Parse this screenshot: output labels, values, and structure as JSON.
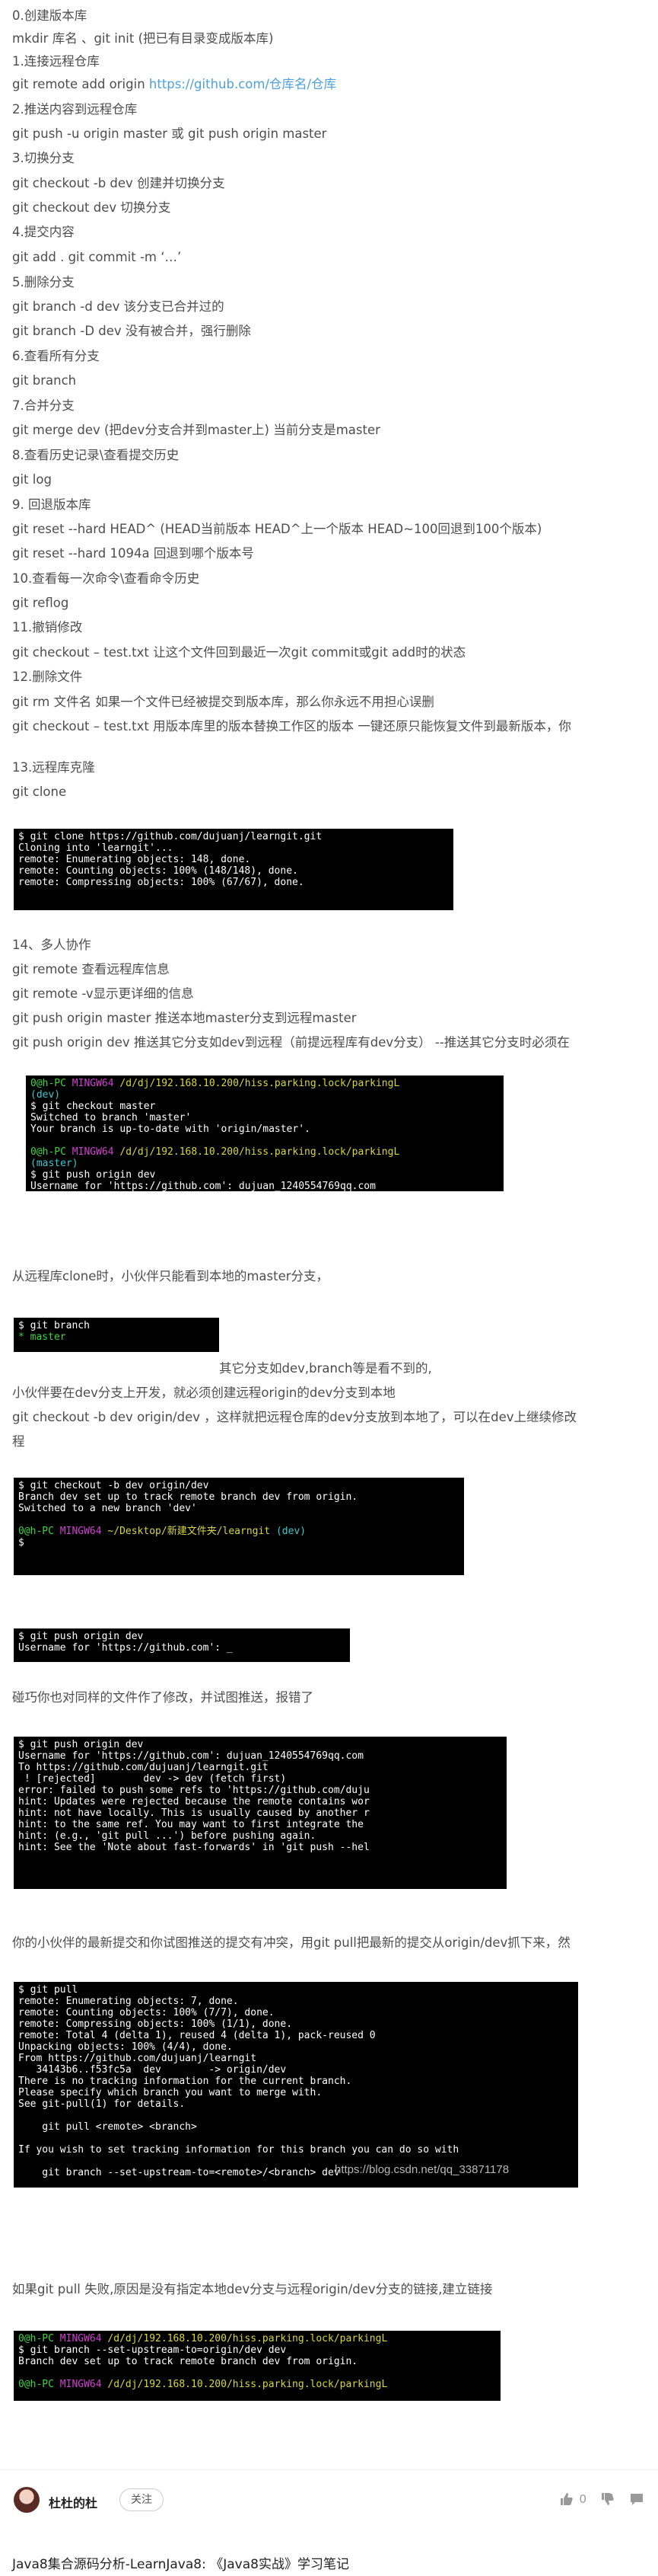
{
  "lines": [
    {
      "text": "0.创建版本库"
    },
    {
      "text": "mkdir 库名 、git init (把已有目录变成版本库)"
    },
    {
      "text": "1.连接远程仓库"
    },
    {
      "text": "git remote add origin ",
      "link": "https://github.com/仓库名/仓库"
    },
    {
      "text": "2.推送内容到远程仓库"
    },
    {
      "text": "git push -u origin master 或 git push origin master"
    },
    {
      "text": "3.切换分支"
    },
    {
      "text": "git checkout -b dev 创建并切换分支"
    },
    {
      "text": "git checkout dev 切换分支"
    },
    {
      "text": "4.提交内容"
    },
    {
      "text": "git add . git commit -m ‘…’"
    },
    {
      "text": "5.删除分支"
    },
    {
      "text": "git branch -d dev 该分支已合并过的"
    },
    {
      "text": "git branch -D dev 没有被合并，强行删除"
    },
    {
      "text": "6.查看所有分支"
    },
    {
      "text": "git branch"
    },
    {
      "text": "7.合并分支"
    },
    {
      "text": "git merge dev (把dev分支合并到master上) 当前分支是master"
    },
    {
      "text": "8.查看历史记录\\查看提交历史"
    },
    {
      "text": "git log"
    },
    {
      "text": "9. 回退版本库"
    },
    {
      "text": "git reset --hard HEAD^ (HEAD当前版本 HEAD^上一个版本 HEAD~100回退到100个版本)"
    },
    {
      "text": "git reset --hard 1094a 回退到哪个版本号"
    },
    {
      "text": "10.查看每一次命令\\查看命令历史"
    },
    {
      "text": "git reflog"
    },
    {
      "text": "11.撤销修改"
    },
    {
      "text": "git checkout – test.txt 让这个文件回到最近一次git commit或git add时的状态"
    },
    {
      "text": "12.删除文件"
    },
    {
      "text": "git rm 文件名 如果一个文件已经被提交到版本库，那么你永远不用担心误删"
    },
    {
      "text": "git checkout – test.txt 用版本库里的版本替换工作区的版本 一键还原只能恢复文件到最新版本，你"
    },
    {
      "text": "13.远程库克隆"
    },
    {
      "text": "git clone"
    },
    {
      "text": "14、多人协作"
    },
    {
      "text": "git remote 查看远程库信息"
    },
    {
      "text": "git remote -v显示更详细的信息"
    },
    {
      "text": "git push origin master 推送本地master分支到远程master"
    },
    {
      "text": "git push origin dev 推送其它分支如dev到远程（前提远程库有dev分支） --推送其它分支时必须在"
    },
    {
      "text": "从远程库clone时，小伙伴只能看到本地的master分支，"
    },
    {
      "text": "其它分支如dev,branch等是看不到的,"
    },
    {
      "text": "小伙伴要在dev分支上开发，就必须创建远程origin的dev分支到本地"
    },
    {
      "text": "git checkout -b dev origin/dev ，这样就把远程仓库的dev分支放到本地了，可以在dev上继续修改"
    },
    {
      "text": "程"
    },
    {
      "text": "碰巧你也对同样的文件作了修改，并试图推送，报错了"
    },
    {
      "text": "你的小伙伴的最新提交和你试图推送的提交有冲突，用git pull把最新的提交从origin/dev抓下来，然"
    },
    {
      "text": "如果git pull 失败,原因是没有指定本地dev分支与远程origin/dev分支的链接,建立链接"
    }
  ],
  "terminals": {
    "clone": [
      "$ git clone https://github.com/dujuanj/learngit.git",
      "Cloning into 'learngit'...",
      "remote: Enumerating objects: 148, done.",
      "remote: Counting objects: 100% (148/148), done.",
      "remote: Compressing objects: 100% (67/67), done."
    ],
    "checkout": {
      "prompt1_user": "0@h-PC",
      "prompt1_env": "MINGW64",
      "prompt1_path": "/d/dj/192.168.10.200/hiss.parking.lock/parkingL",
      "prompt1_branch": "(dev)",
      "cmd1": "$ git checkout master",
      "out1": "Switched to branch 'master'",
      "out2": "Your branch is up-to-date with 'origin/master'.",
      "prompt2_user": "0@h-PC",
      "prompt2_env": "MINGW64",
      "prompt2_path": "/d/dj/192.168.10.200/hiss.parking.lock/parkingL",
      "prompt2_branch": "(master)",
      "cmd2": "$ git push origin dev",
      "out3": "Username for 'https://github.com': dujuan_1240554769qq.com"
    },
    "branch": {
      "cmd": "$ git branch",
      "out": "* master"
    },
    "newdev": {
      "cmd": "$ git checkout -b dev origin/dev",
      "out1": "Branch dev set up to track remote branch dev from origin.",
      "out2": "Switched to a new branch 'dev'",
      "prompt_user": "0@h-PC",
      "prompt_env": "MINGW64",
      "prompt_path": "~/Desktop/新建文件夹/learngit",
      "prompt_branch": "(dev)",
      "cmd2": "$"
    },
    "pushdev": [
      "$ git push origin dev",
      "Username for 'https://github.com': _"
    ],
    "rejected": [
      "$ git push origin dev",
      "Username for 'https://github.com': dujuan_1240554769qq.com",
      "To https://github.com/dujuanj/learngit.git",
      " ! [rejected]        dev -> dev (fetch first)",
      "error: failed to push some refs to 'https://github.com/duju",
      "hint: Updates were rejected because the remote contains wor",
      "hint: not have locally. This is usually caused by another r",
      "hint: to the same ref. You may want to first integrate the ",
      "hint: (e.g., 'git pull ...') before pushing again.",
      "hint: See the 'Note about fast-forwards' in 'git push --hel"
    ],
    "pull": [
      "$ git pull",
      "remote: Enumerating objects: 7, done.",
      "remote: Counting objects: 100% (7/7), done.",
      "remote: Compressing objects: 100% (1/1), done.",
      "remote: Total 4 (delta 1), reused 4 (delta 1), pack-reused 0",
      "Unpacking objects: 100% (4/4), done.",
      "From https://github.com/dujuanj/learngit",
      "   34143b6..f53fc5a  dev        -> origin/dev",
      "There is no tracking information for the current branch.",
      "Please specify which branch you want to merge with.",
      "See git-pull(1) for details.",
      "",
      "    git pull <remote> <branch>",
      "",
      "If you wish to set tracking information for this branch you can do so with",
      "",
      "    git branch --set-upstream-to=<remote>/<branch> dev"
    ],
    "upstream": {
      "prompt1_user": "0@h-PC",
      "prompt1_env": "MINGW64",
      "prompt1_path": "/d/dj/192.168.10.200/hiss.parking.lock/parkingL",
      "cmd": "$ git branch --set-upstream-to=origin/dev dev",
      "out": "Branch dev set up to track remote branch dev from origin.",
      "prompt2_user": "0@h-PC",
      "prompt2_env": "MINGW64",
      "prompt2_path": "/d/dj/192.168.10.200/hiss.parking.lock/parkingL"
    }
  },
  "watermark": "https://blog.csdn.net/qq_33871178",
  "footer": {
    "author": "杜杜的杜",
    "follow_label": "关注",
    "like_count": "0"
  },
  "related": "Java8集合源码分析-LearnJava8: 《Java8实战》学习笔记",
  "colors": {
    "link": "#4ea1db",
    "terminal_bg": "#000000",
    "prompt_green": "#3ed43e",
    "prompt_magenta": "#d040d0",
    "prompt_yellow": "#d6d640",
    "prompt_cyan": "#3cc8d0"
  }
}
